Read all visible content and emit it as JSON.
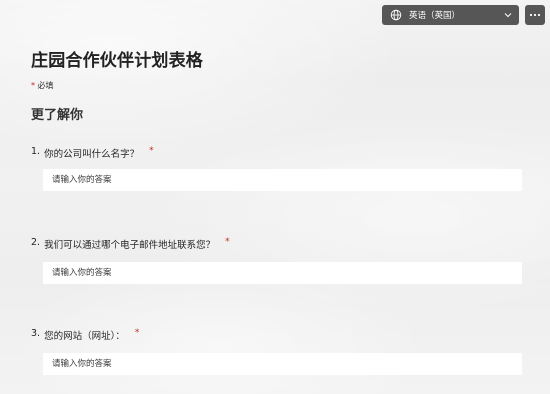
{
  "header": {
    "language_label": "英语（英国）"
  },
  "form": {
    "title": "庄园合作伙伴计划表格",
    "required_star": "*",
    "required_text": "必填",
    "section_title": "更了解你",
    "questions": [
      {
        "number": "1.",
        "text": "你的公司叫什么名字？",
        "required_star": "*",
        "placeholder": "请输入你的答案"
      },
      {
        "number": "2.",
        "text": "我们可以通过哪个电子邮件地址联系您？",
        "required_star": "*",
        "placeholder": "请输入你的答案"
      },
      {
        "number": "3.",
        "text": "您的网站（网址）：",
        "required_star": "*",
        "placeholder": "请输入你的答案"
      }
    ]
  },
  "icons": {
    "globe": "globe-icon",
    "chevron": "chevron-down-icon",
    "more": "more-options-icon"
  },
  "colors": {
    "toolbar_bg": "#565656",
    "required": "#c42b1c",
    "input_bg": "#ffffff"
  }
}
